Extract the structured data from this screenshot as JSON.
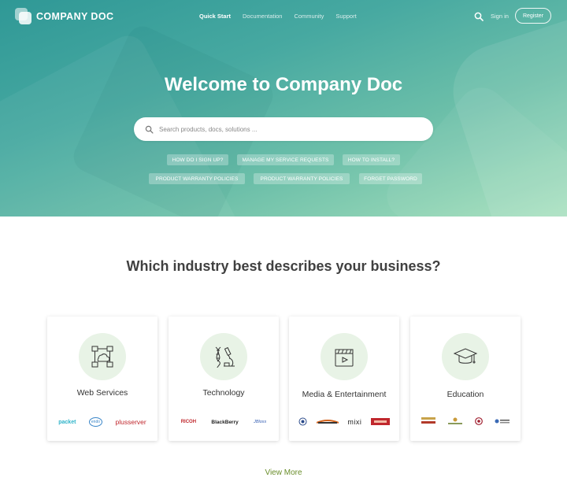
{
  "brand": {
    "name": "COMPANY DOC"
  },
  "nav": {
    "items": [
      {
        "label": "Quick Start",
        "active": true
      },
      {
        "label": "Documentation",
        "active": false
      },
      {
        "label": "Community",
        "active": false
      },
      {
        "label": "Support",
        "active": false
      }
    ],
    "sign_in": "Sign in",
    "register": "Register"
  },
  "hero": {
    "title": "Welcome to Company Doc",
    "search_placeholder": "Search products, docs, solutions ...",
    "chips": [
      "HOW DO I SIGN UP?",
      "MANAGE MY SERVICE REQUESTS",
      "HOW TO INSTALL?",
      "PRODUCT WARRANTY POLICIES",
      "PRODUCT WARRANTY POLICIES",
      "FORGET PASSWORD"
    ]
  },
  "section": {
    "title": "Which industry best describes your business?",
    "cards": [
      {
        "title": "Web Services",
        "icon": "network-icon",
        "logos": [
          "packet",
          "endo",
          "plusserver"
        ]
      },
      {
        "title": "Technology",
        "icon": "dna-microscope-icon",
        "logos": [
          "RICOH",
          "BlackBerry",
          "JBloss"
        ]
      },
      {
        "title": "Media & Entertainment",
        "icon": "clapperboard-icon",
        "logos": [
          "seal",
          "emblem",
          "mixi",
          "vox"
        ]
      },
      {
        "title": "Education",
        "icon": "graduation-cap-icon",
        "logos": [
          "crest",
          "college",
          "shield",
          "univ"
        ]
      }
    ],
    "view_more": "View More"
  },
  "colors": {
    "accent_green": "#6a8e2b",
    "hero_teal": "#3aa09b",
    "hero_mint": "#a6e0bd",
    "icon_bg": "#e8f3e6"
  }
}
